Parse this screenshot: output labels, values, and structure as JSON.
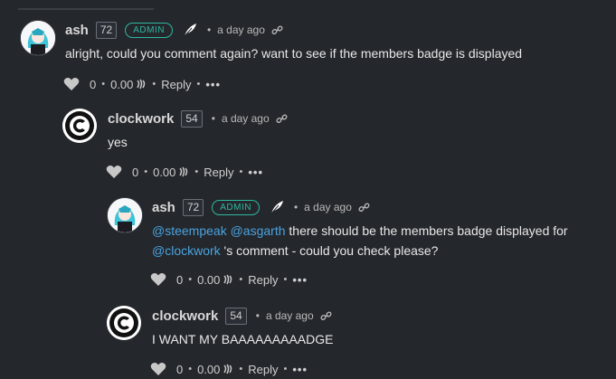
{
  "comments": [
    {
      "author": "ash",
      "reputation": "72",
      "badge": "ADMIN",
      "time": "a day ago",
      "body_text": "alright, could you comment again? want to see if the members badge is displayed",
      "votes": "0",
      "payout": "0.00",
      "reply_label": "Reply",
      "more_label": "•••"
    },
    {
      "author": "clockwork",
      "reputation": "54",
      "time": "a day ago",
      "body_text": "yes",
      "votes": "0",
      "payout": "0.00",
      "reply_label": "Reply",
      "more_label": "•••"
    },
    {
      "author": "ash",
      "reputation": "72",
      "badge": "ADMIN",
      "time": "a day ago",
      "body_parts": {
        "mention1": "@steempeak",
        "mention2": "@asgarth",
        "text1": " there should be the members badge displayed for",
        "mention3": "@clockwork",
        "text2": " 's comment - could you check please?"
      },
      "votes": "0",
      "payout": "0.00",
      "reply_label": "Reply",
      "more_label": "•••"
    },
    {
      "author": "clockwork",
      "reputation": "54",
      "time": "a day ago",
      "body_text": "I WANT MY BAAAAAAAAADGE",
      "votes": "0",
      "payout": "0.00",
      "reply_label": "Reply",
      "more_label": "•••"
    }
  ],
  "colors": {
    "background": "#24272c",
    "admin_badge": "#2fb8a0",
    "mention": "#4aa3df"
  },
  "icons": [
    "avatar-ash",
    "clockwork-logo",
    "feather-icon",
    "link-icon",
    "heart-icon",
    "steem-icon"
  ]
}
